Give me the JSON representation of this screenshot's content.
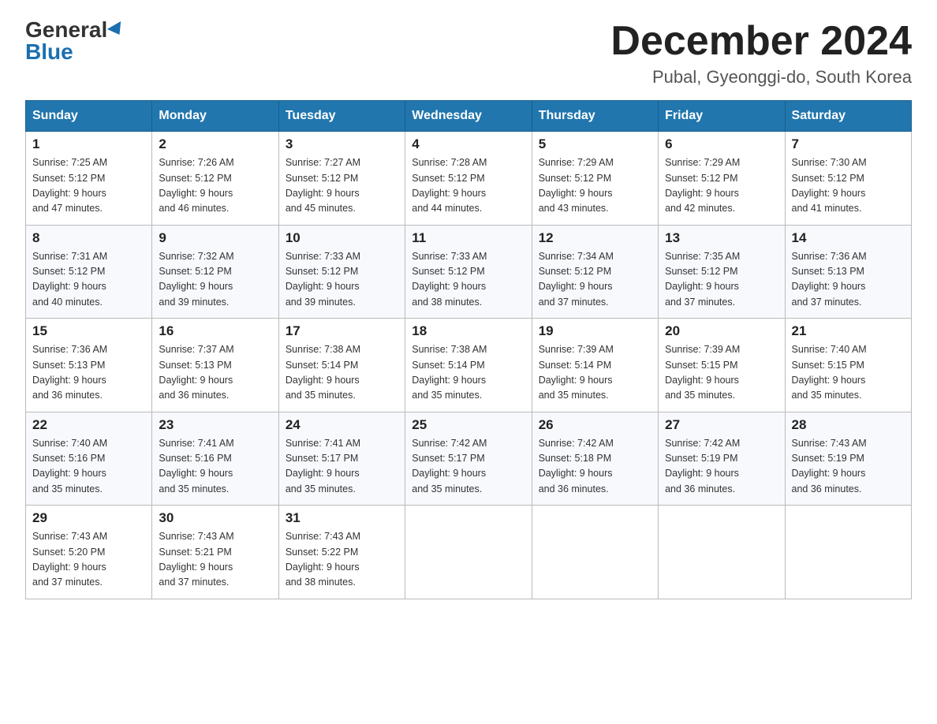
{
  "logo": {
    "general": "General",
    "blue": "Blue"
  },
  "header": {
    "month_year": "December 2024",
    "location": "Pubal, Gyeonggi-do, South Korea"
  },
  "weekdays": [
    "Sunday",
    "Monday",
    "Tuesday",
    "Wednesday",
    "Thursday",
    "Friday",
    "Saturday"
  ],
  "weeks": [
    [
      {
        "day": "1",
        "sunrise": "7:25 AM",
        "sunset": "5:12 PM",
        "daylight": "9 hours and 47 minutes."
      },
      {
        "day": "2",
        "sunrise": "7:26 AM",
        "sunset": "5:12 PM",
        "daylight": "9 hours and 46 minutes."
      },
      {
        "day": "3",
        "sunrise": "7:27 AM",
        "sunset": "5:12 PM",
        "daylight": "9 hours and 45 minutes."
      },
      {
        "day": "4",
        "sunrise": "7:28 AM",
        "sunset": "5:12 PM",
        "daylight": "9 hours and 44 minutes."
      },
      {
        "day": "5",
        "sunrise": "7:29 AM",
        "sunset": "5:12 PM",
        "daylight": "9 hours and 43 minutes."
      },
      {
        "day": "6",
        "sunrise": "7:29 AM",
        "sunset": "5:12 PM",
        "daylight": "9 hours and 42 minutes."
      },
      {
        "day": "7",
        "sunrise": "7:30 AM",
        "sunset": "5:12 PM",
        "daylight": "9 hours and 41 minutes."
      }
    ],
    [
      {
        "day": "8",
        "sunrise": "7:31 AM",
        "sunset": "5:12 PM",
        "daylight": "9 hours and 40 minutes."
      },
      {
        "day": "9",
        "sunrise": "7:32 AM",
        "sunset": "5:12 PM",
        "daylight": "9 hours and 39 minutes."
      },
      {
        "day": "10",
        "sunrise": "7:33 AM",
        "sunset": "5:12 PM",
        "daylight": "9 hours and 39 minutes."
      },
      {
        "day": "11",
        "sunrise": "7:33 AM",
        "sunset": "5:12 PM",
        "daylight": "9 hours and 38 minutes."
      },
      {
        "day": "12",
        "sunrise": "7:34 AM",
        "sunset": "5:12 PM",
        "daylight": "9 hours and 37 minutes."
      },
      {
        "day": "13",
        "sunrise": "7:35 AM",
        "sunset": "5:12 PM",
        "daylight": "9 hours and 37 minutes."
      },
      {
        "day": "14",
        "sunrise": "7:36 AM",
        "sunset": "5:13 PM",
        "daylight": "9 hours and 37 minutes."
      }
    ],
    [
      {
        "day": "15",
        "sunrise": "7:36 AM",
        "sunset": "5:13 PM",
        "daylight": "9 hours and 36 minutes."
      },
      {
        "day": "16",
        "sunrise": "7:37 AM",
        "sunset": "5:13 PM",
        "daylight": "9 hours and 36 minutes."
      },
      {
        "day": "17",
        "sunrise": "7:38 AM",
        "sunset": "5:14 PM",
        "daylight": "9 hours and 35 minutes."
      },
      {
        "day": "18",
        "sunrise": "7:38 AM",
        "sunset": "5:14 PM",
        "daylight": "9 hours and 35 minutes."
      },
      {
        "day": "19",
        "sunrise": "7:39 AM",
        "sunset": "5:14 PM",
        "daylight": "9 hours and 35 minutes."
      },
      {
        "day": "20",
        "sunrise": "7:39 AM",
        "sunset": "5:15 PM",
        "daylight": "9 hours and 35 minutes."
      },
      {
        "day": "21",
        "sunrise": "7:40 AM",
        "sunset": "5:15 PM",
        "daylight": "9 hours and 35 minutes."
      }
    ],
    [
      {
        "day": "22",
        "sunrise": "7:40 AM",
        "sunset": "5:16 PM",
        "daylight": "9 hours and 35 minutes."
      },
      {
        "day": "23",
        "sunrise": "7:41 AM",
        "sunset": "5:16 PM",
        "daylight": "9 hours and 35 minutes."
      },
      {
        "day": "24",
        "sunrise": "7:41 AM",
        "sunset": "5:17 PM",
        "daylight": "9 hours and 35 minutes."
      },
      {
        "day": "25",
        "sunrise": "7:42 AM",
        "sunset": "5:17 PM",
        "daylight": "9 hours and 35 minutes."
      },
      {
        "day": "26",
        "sunrise": "7:42 AM",
        "sunset": "5:18 PM",
        "daylight": "9 hours and 36 minutes."
      },
      {
        "day": "27",
        "sunrise": "7:42 AM",
        "sunset": "5:19 PM",
        "daylight": "9 hours and 36 minutes."
      },
      {
        "day": "28",
        "sunrise": "7:43 AM",
        "sunset": "5:19 PM",
        "daylight": "9 hours and 36 minutes."
      }
    ],
    [
      {
        "day": "29",
        "sunrise": "7:43 AM",
        "sunset": "5:20 PM",
        "daylight": "9 hours and 37 minutes."
      },
      {
        "day": "30",
        "sunrise": "7:43 AM",
        "sunset": "5:21 PM",
        "daylight": "9 hours and 37 minutes."
      },
      {
        "day": "31",
        "sunrise": "7:43 AM",
        "sunset": "5:22 PM",
        "daylight": "9 hours and 38 minutes."
      },
      null,
      null,
      null,
      null
    ]
  ],
  "labels": {
    "sunrise": "Sunrise:",
    "sunset": "Sunset:",
    "daylight": "Daylight:"
  }
}
